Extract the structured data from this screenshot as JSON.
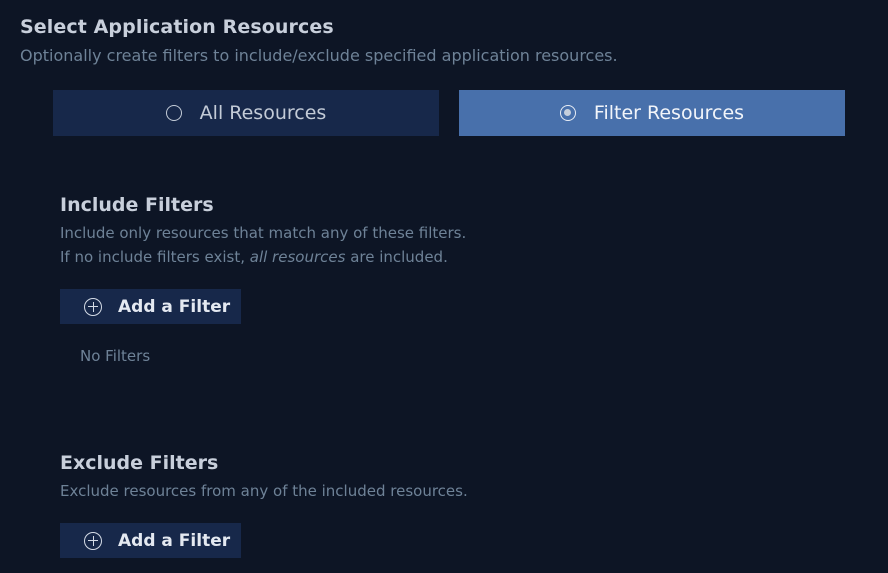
{
  "header": {
    "title": "Select Application Resources",
    "subtitle": "Optionally create filters to include/exclude specified application resources."
  },
  "mode_toggle": {
    "options": [
      {
        "label": "All Resources",
        "selected": false
      },
      {
        "label": "Filter Resources",
        "selected": true
      }
    ],
    "selected_color": "#4870ab"
  },
  "include_filters": {
    "title": "Include Filters",
    "desc_line1": "Include only resources that match any of these filters.",
    "desc_line2_prefix": "If no include filters exist, ",
    "desc_line2_emphasis": "all resources",
    "desc_line2_suffix": " are included.",
    "add_button": "Add a Filter",
    "add_button_icon": "plus-circle-icon",
    "empty_text": "No Filters"
  },
  "exclude_filters": {
    "title": "Exclude Filters",
    "desc_line1": "Exclude resources from any of the included resources.",
    "add_button": "Add a Filter",
    "add_button_icon": "plus-circle-icon"
  }
}
